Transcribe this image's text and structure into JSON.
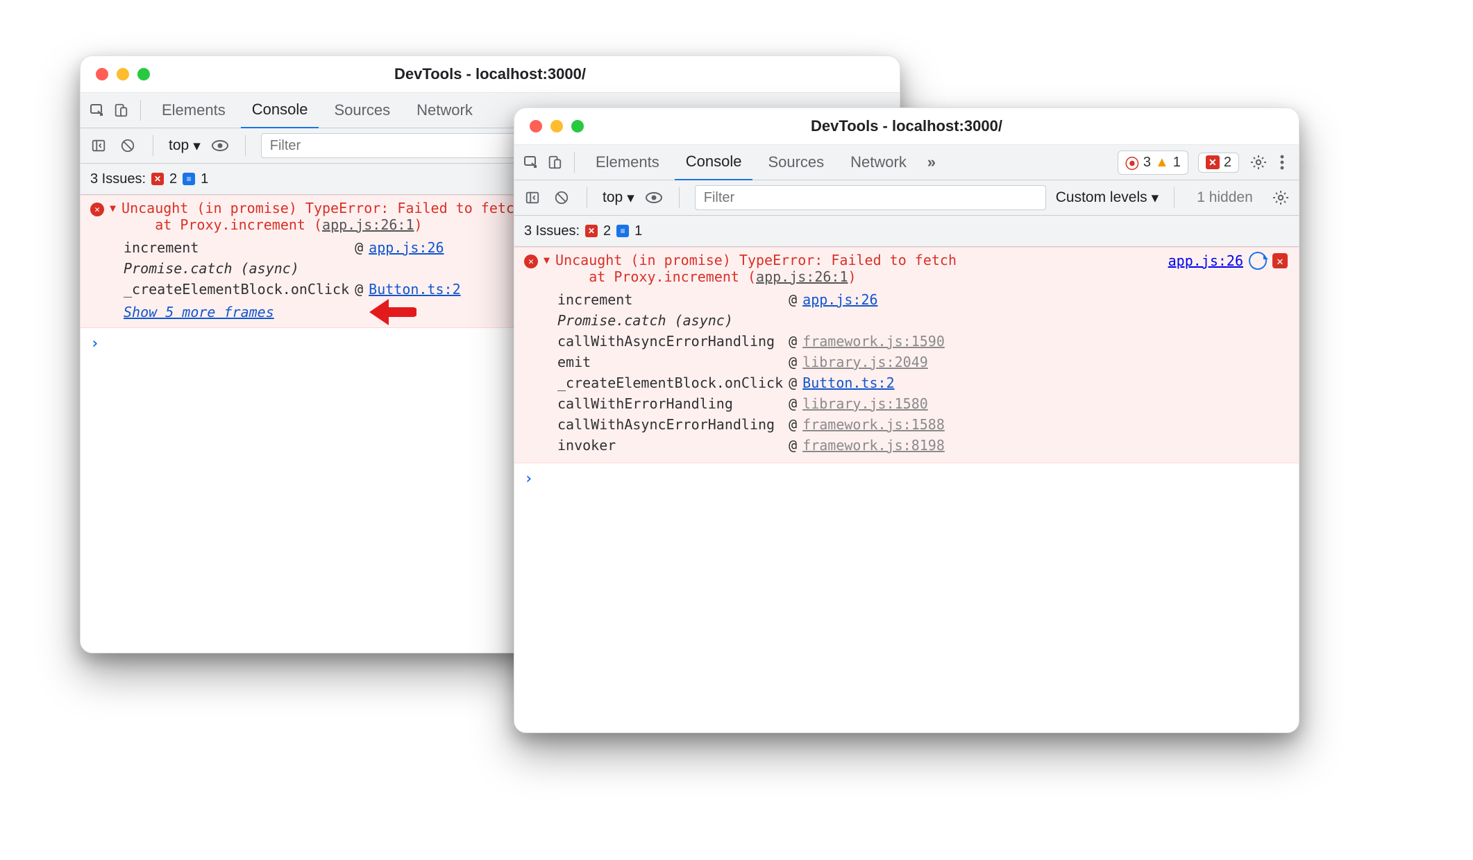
{
  "window_title": "DevTools - localhost:3000/",
  "tabs": [
    "Elements",
    "Console",
    "Sources",
    "Network"
  ],
  "active_tab": "Console",
  "filter_placeholder": "Filter",
  "levels_label": "Custom levels",
  "hidden_label": "1 hidden",
  "issues_label": "3 Issues:",
  "issues_counts": {
    "errors": "2",
    "messages": "1"
  },
  "top_context": "top",
  "win2_badges": {
    "errors": "3",
    "warnings": "1",
    "x_errors": "2"
  },
  "error": {
    "message": "Uncaught (in promise) TypeError: Failed to fetch",
    "at_line": "at Proxy.increment (",
    "at_src": "app.js:26:1",
    "at_line_close": ")",
    "source_link": "app.js:26"
  },
  "win1": {
    "rows": [
      {
        "fn": "increment",
        "at": "@",
        "src": "app.js:26",
        "muted": false
      },
      {
        "fn": "Promise.catch (async)",
        "async": true
      },
      {
        "fn": "_createElementBlock.onClick",
        "at": "@",
        "src": "Button.ts:2",
        "muted": false
      }
    ],
    "show_more": "Show 5 more frames"
  },
  "win2": {
    "rows": [
      {
        "fn": "increment",
        "at": "@",
        "src": "app.js:26",
        "muted": false
      },
      {
        "fn": "Promise.catch (async)",
        "async": true
      },
      {
        "fn": "callWithAsyncErrorHandling",
        "at": "@",
        "src": "framework.js:1590",
        "muted": true
      },
      {
        "fn": "emit",
        "at": "@",
        "src": "library.js:2049",
        "muted": true
      },
      {
        "fn": "_createElementBlock.onClick",
        "at": "@",
        "src": "Button.ts:2",
        "muted": false
      },
      {
        "fn": "callWithErrorHandling",
        "at": "@",
        "src": "library.js:1580",
        "muted": true
      },
      {
        "fn": "callWithAsyncErrorHandling",
        "at": "@",
        "src": "framework.js:1588",
        "muted": true
      },
      {
        "fn": "invoker",
        "at": "@",
        "src": "framework.js:8198",
        "muted": true
      }
    ]
  }
}
